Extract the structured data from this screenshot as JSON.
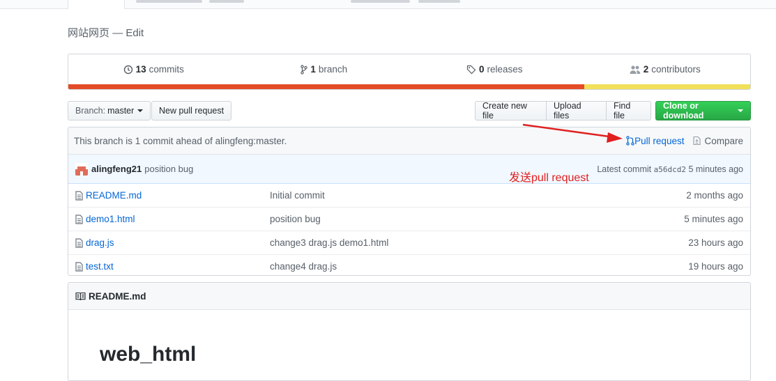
{
  "repo": {
    "description": "网站网页",
    "separator": "—",
    "edit_label": "Edit"
  },
  "summary": {
    "commits": {
      "count": "13",
      "label": "commits"
    },
    "branches": {
      "count": "1",
      "label": "branch"
    },
    "releases": {
      "count": "0",
      "label": "releases"
    },
    "contributors": {
      "count": "2",
      "label": "contributors"
    },
    "languages": [
      {
        "color": "#e34c26",
        "fraction": 0.757
      },
      {
        "color": "#f1e05a",
        "fraction": 0.243
      }
    ]
  },
  "toolbar": {
    "branch_prefix": "Branch:",
    "branch_name": "master",
    "new_pull_request": "New pull request",
    "create_new_file": "Create new file",
    "upload_files": "Upload files",
    "find_file": "Find file",
    "clone_or_download": "Clone or download"
  },
  "ahead_bar": {
    "message": "This branch is 1 commit ahead of alingfeng:master.",
    "pull_request": "Pull request",
    "compare": "Compare"
  },
  "latest_commit": {
    "author": "alingfeng21",
    "message": "position bug",
    "prefix": "Latest commit",
    "sha": "a56dcd2",
    "time": "5 minutes ago"
  },
  "files": [
    {
      "name": "README.md",
      "message": "Initial commit",
      "age": "2 months ago"
    },
    {
      "name": "demo1.html",
      "message": "position bug",
      "age": "5 minutes ago"
    },
    {
      "name": "drag.js",
      "message": "change3 drag.js demo1.html",
      "age": "23 hours ago"
    },
    {
      "name": "test.txt",
      "message": "change4 drag.js",
      "age": "19 hours ago"
    }
  ],
  "readme": {
    "filename": "README.md",
    "heading": "web_html"
  },
  "annotation": {
    "text": "发送pull request",
    "color": "#e02020"
  }
}
